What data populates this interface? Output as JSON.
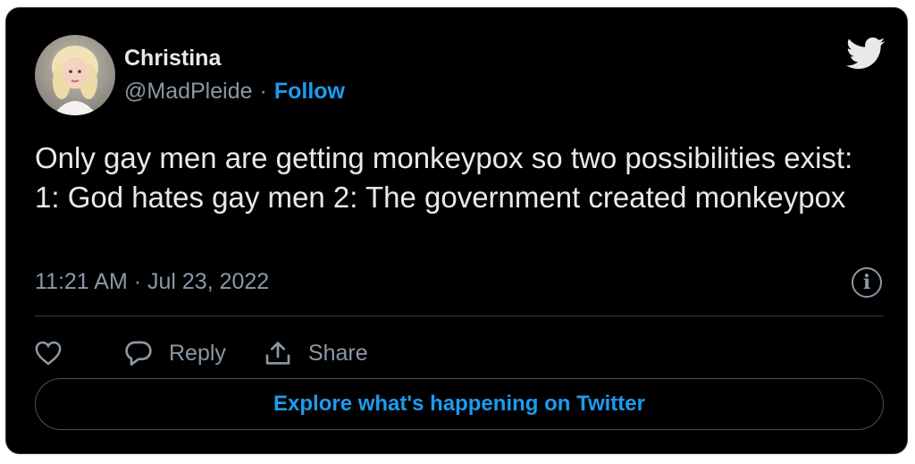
{
  "tweet": {
    "author_name": "Christina",
    "author_handle": "@MadPleide",
    "separator": "·",
    "follow_label": "Follow",
    "text": "Only gay men are getting monkeypox so two possibilities exist: 1: God hates gay men 2: The government created monkeypox",
    "timestamp": "11:21 AM · Jul 23, 2022"
  },
  "actions": {
    "reply_label": "Reply",
    "share_label": "Share"
  },
  "explore_label": "Explore what's happening on Twitter",
  "icons": {
    "logo": "twitter-bird-icon",
    "info": "info-icon",
    "like": "heart-icon",
    "reply": "reply-bubble-icon",
    "share": "share-icon"
  },
  "colors": {
    "background": "#000000",
    "text": "#e7e9ea",
    "secondary_text": "#8b98a5",
    "accent": "#1d9bf0",
    "border": "#3a3a3a"
  }
}
